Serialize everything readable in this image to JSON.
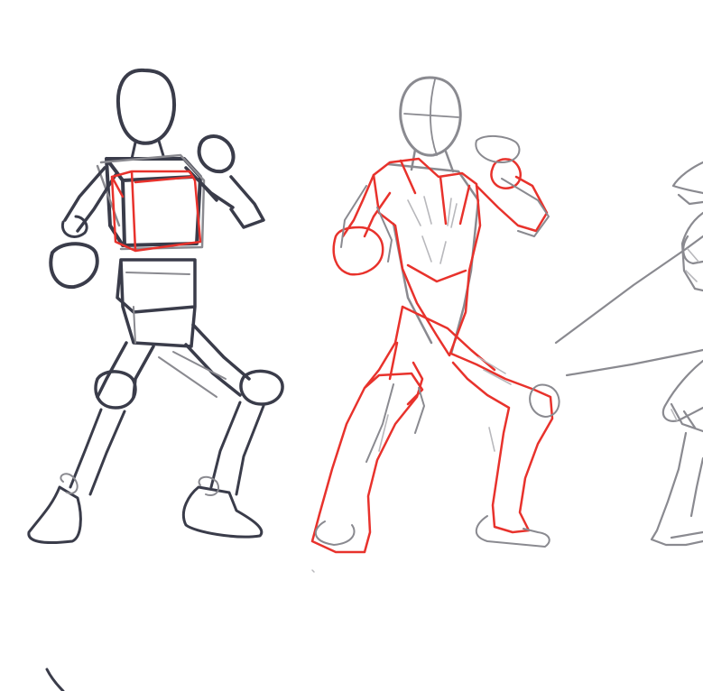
{
  "image": {
    "subject": "",
    "colors": {
      "background": "#ffffff",
      "mannequin_stroke": "#3a3c4a",
      "underdrawing_stroke": "#8a8a90",
      "faint_stroke": "#b8b8bc",
      "construction_stroke": "#e8322c"
    }
  }
}
